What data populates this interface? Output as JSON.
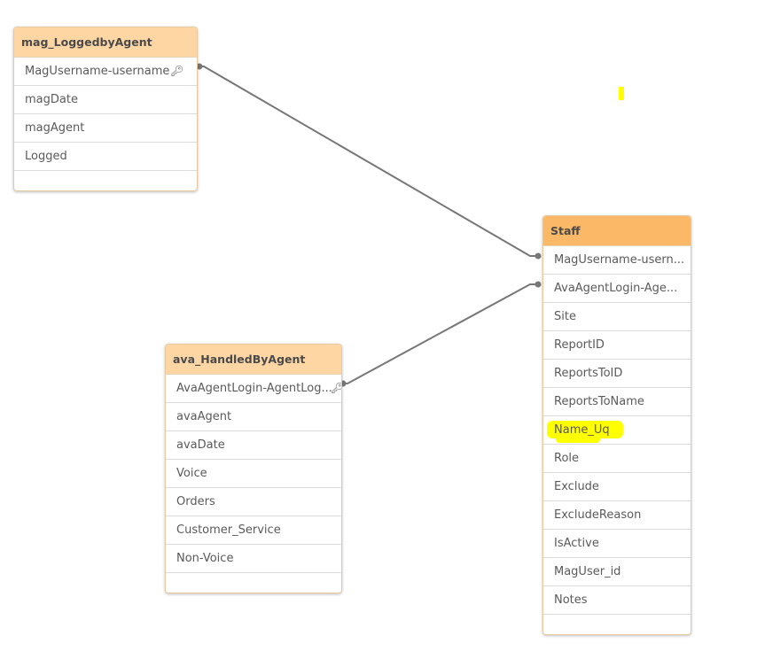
{
  "tables": {
    "mag": {
      "title": "mag_LoggedbyAgent",
      "fields": [
        "MagUsername-username",
        "magDate",
        "magAgent",
        "Logged"
      ],
      "key_field_index": 0
    },
    "ava": {
      "title": "ava_HandledByAgent",
      "fields": [
        "AvaAgentLogin-AgentLog...",
        "avaAgent",
        "avaDate",
        "Voice",
        "Orders",
        "Customer_Service",
        "Non-Voice"
      ],
      "key_field_index": 0
    },
    "staff": {
      "title": "Staff",
      "fields": [
        "MagUsername-usern...",
        "AvaAgentLogin-Age...",
        "Site",
        "ReportID",
        "ReportsToID",
        "ReportsToName",
        "Name_Uq",
        "Role",
        "Exclude",
        "ExcludeReason",
        "IsActive",
        "MagUser_id",
        "Notes"
      ],
      "highlighted_field": "Name_Uq"
    }
  },
  "links": [
    {
      "from": "mag_LoggedbyAgent.MagUsername-username",
      "to": "Staff.MagUsername-usern..."
    },
    {
      "from": "ava_HandledByAgent.AvaAgentLogin-AgentLog...",
      "to": "Staff.AvaAgentLogin-Age..."
    }
  ],
  "icons": {
    "key": "key-icon"
  },
  "colors": {
    "header_light": "#fdd6a4",
    "header_selected": "#fbb866",
    "link_line": "#777777",
    "highlight": "#ffff00"
  }
}
